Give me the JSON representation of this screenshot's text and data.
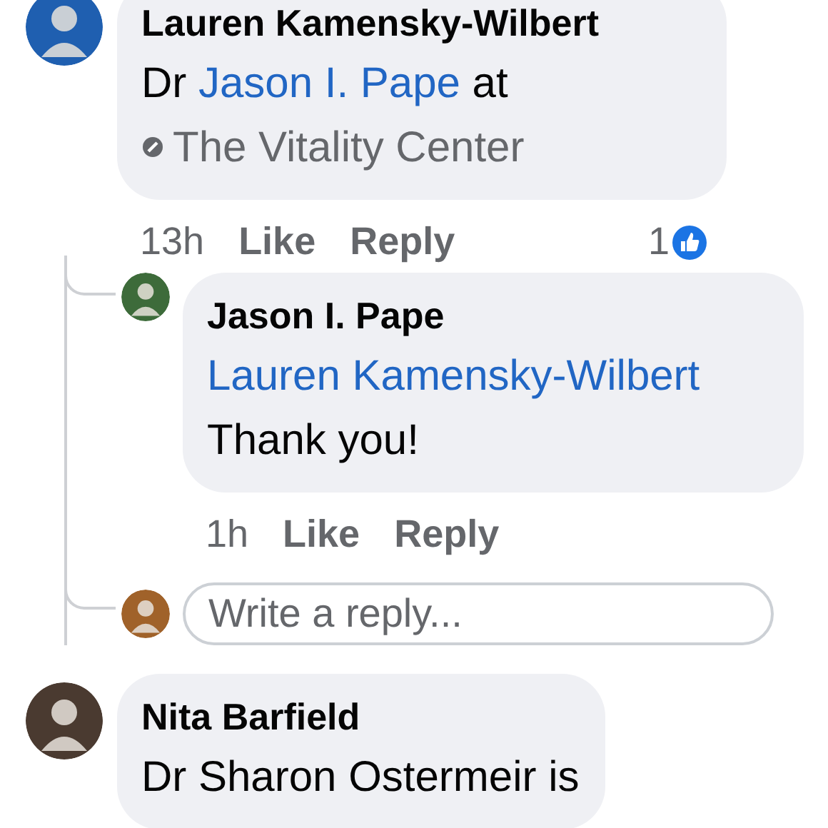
{
  "comments": [
    {
      "author": "Lauren Kamensky-Wilbert",
      "segments": [
        {
          "kind": "text",
          "text": "Dr "
        },
        {
          "kind": "mention",
          "text": "Jason I. Pape"
        },
        {
          "kind": "text",
          "text": " at "
        },
        {
          "kind": "place",
          "text": "The Vitality Center"
        }
      ],
      "time": "13h",
      "actions": [
        "Like",
        "Reply"
      ],
      "reaction_count": "1",
      "replies": [
        {
          "author": "Jason I. Pape",
          "segments": [
            {
              "kind": "mention",
              "text": "Lauren Kamensky-Wilbert"
            },
            {
              "kind": "text",
              "text": " Thank you!"
            }
          ],
          "time": "1h",
          "actions": [
            "Like",
            "Reply"
          ]
        }
      ],
      "reply_box": {
        "placeholder": "Write a reply..."
      }
    },
    {
      "author": "Nita Barfield",
      "segments": [
        {
          "kind": "text",
          "text": "Dr Sharon Ostermeir is"
        }
      ]
    }
  ]
}
